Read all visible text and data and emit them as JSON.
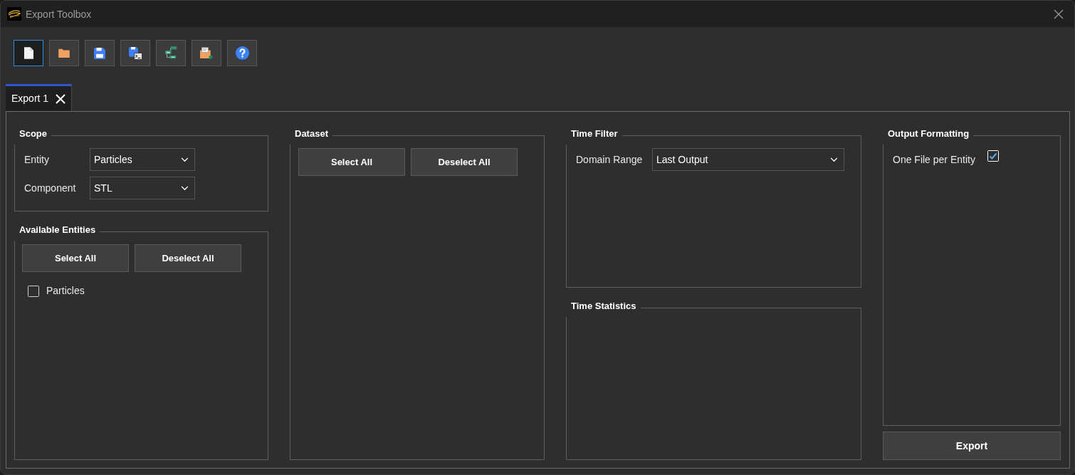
{
  "window": {
    "title": "Export Toolbox"
  },
  "toolbar": [
    {
      "kind": "new",
      "selected": true
    },
    {
      "kind": "open",
      "selected": false
    },
    {
      "kind": "save",
      "selected": false
    },
    {
      "kind": "save-script",
      "selected": false
    },
    {
      "kind": "tree",
      "selected": false
    },
    {
      "kind": "folder-gear",
      "selected": false
    },
    {
      "kind": "help",
      "selected": false
    }
  ],
  "tabs": [
    {
      "label": "Export 1",
      "selected": true
    }
  ],
  "scope": {
    "title": "Scope",
    "fields": [
      {
        "label": "Entity",
        "value": "Particles"
      },
      {
        "label": "Component",
        "value": "STL"
      }
    ]
  },
  "available_entities": {
    "title": "Available Entities",
    "buttons": [
      "Select All",
      "Deselect All"
    ],
    "items": [
      {
        "label": "Particles",
        "checked": false
      }
    ]
  },
  "dataset": {
    "title": "Dataset",
    "buttons": [
      "Select All",
      "Deselect All"
    ]
  },
  "time_filter": {
    "title": "Time Filter",
    "fields": [
      {
        "label": "Domain Range",
        "value": "Last Output"
      }
    ]
  },
  "time_statistics": {
    "title": "Time Statistics"
  },
  "output_formatting": {
    "title": "Output Formatting",
    "options": [
      {
        "label": "One File per Entity",
        "checked": true
      }
    ]
  },
  "export_button": "Export"
}
